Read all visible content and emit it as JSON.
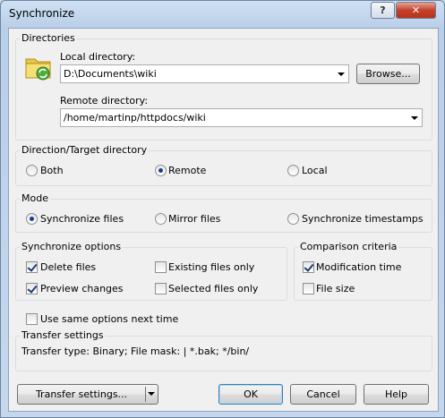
{
  "window": {
    "title": "Synchronize"
  },
  "titlebar_buttons": {
    "help": "?",
    "close": "✕"
  },
  "directories": {
    "legend": "Directories",
    "local_label": "Local directory:",
    "local_value": "D:\\Documents\\wiki",
    "browse_button": "Browse...",
    "remote_label": "Remote directory:",
    "remote_value": "/home/martinp/httpdocs/wiki"
  },
  "direction": {
    "legend": "Direction/Target directory",
    "options": [
      {
        "label": "Both",
        "selected": false
      },
      {
        "label": "Remote",
        "selected": true
      },
      {
        "label": "Local",
        "selected": false
      }
    ]
  },
  "mode": {
    "legend": "Mode",
    "options": [
      {
        "label": "Synchronize files",
        "selected": true
      },
      {
        "label": "Mirror files",
        "selected": false
      },
      {
        "label": "Synchronize timestamps",
        "selected": false
      }
    ]
  },
  "sync_options": {
    "legend": "Synchronize options",
    "items": [
      {
        "label": "Delete files",
        "checked": true
      },
      {
        "label": "Existing files only",
        "checked": false
      },
      {
        "label": "Preview changes",
        "checked": true
      },
      {
        "label": "Selected files only",
        "checked": false
      }
    ]
  },
  "comparison": {
    "legend": "Comparison criteria",
    "items": [
      {
        "label": "Modification time",
        "checked": true
      },
      {
        "label": "File size",
        "checked": false
      }
    ]
  },
  "use_same_options": {
    "label": "Use same options next time",
    "checked": false
  },
  "transfer_settings": {
    "legend": "Transfer settings",
    "text": "Transfer type: Binary; File mask: | *.bak; */bin/"
  },
  "footer": {
    "transfer_settings_button": "Transfer settings...",
    "ok_button": "OK",
    "cancel_button": "Cancel",
    "help_button": "Help"
  }
}
